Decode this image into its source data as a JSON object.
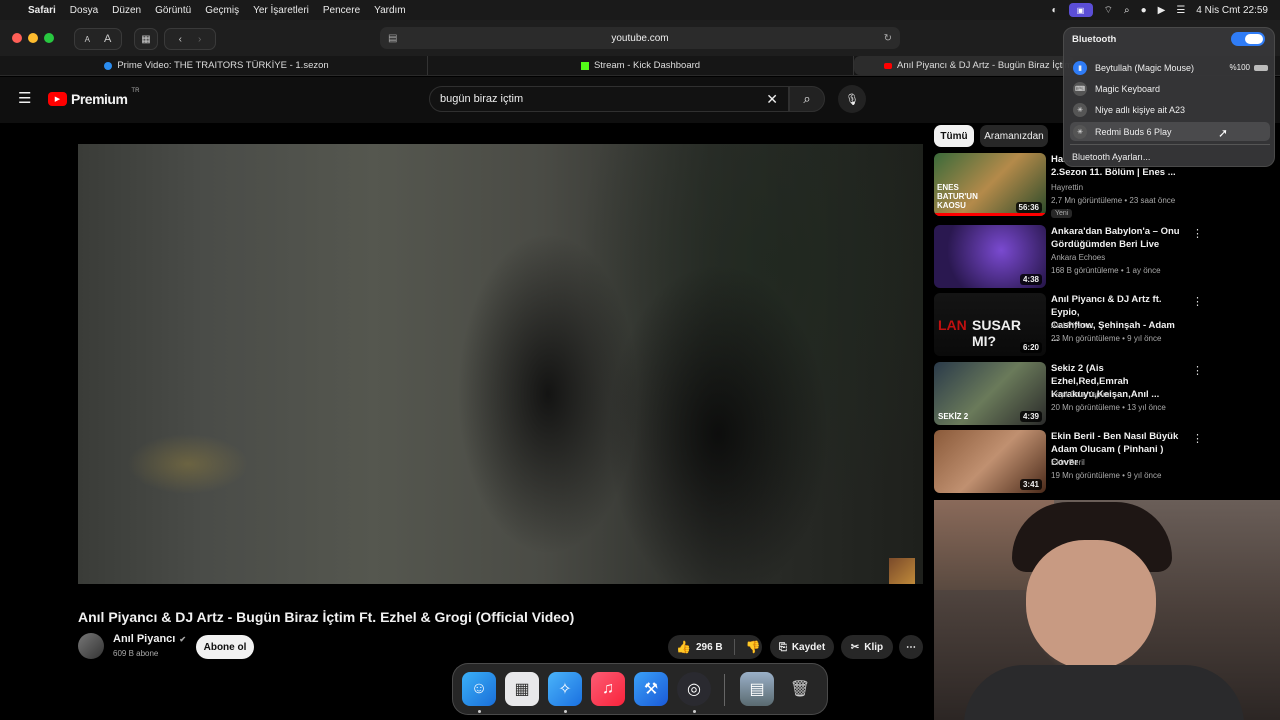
{
  "menubar": {
    "apple": "",
    "items": [
      "Safari",
      "Dosya",
      "Düzen",
      "Görüntü",
      "Geçmiş",
      "Yer İşaretleri",
      "Pencere",
      "Yardım"
    ],
    "clock": "4 Nis Cmt  22:59"
  },
  "safari": {
    "reader_small": "A",
    "reader_large": "A",
    "url": "youtube.com",
    "tabs": [
      {
        "label": "Prime Video: THE TRAITORS TÜRKİYE - 1.sezon"
      },
      {
        "label": "Stream - Kick Dashboard"
      },
      {
        "label": "Anıl Piyancı & DJ Artz - Bugün Biraz İçtim"
      }
    ]
  },
  "youtube": {
    "logo": "Premium",
    "region": "TR",
    "search_value": "bugün biraz içtim",
    "video_title": "Anıl Piyancı & DJ Artz - Bugün Biraz İçtim Ft. Ezhel & Grogi (Official Video)",
    "channel": "Anıl Piyancı",
    "subscribers": "609 B abone",
    "subscribe_label": "Abone ol",
    "likes": "296 B",
    "save_label": "Kaydet",
    "clip_label": "Klip",
    "chips": [
      "Tümü",
      "Aramanızdan"
    ],
    "recommendations": [
      {
        "title_line1": "Ha...",
        "title_line2": "2.Sezon 11. Bölüm | Enes ...",
        "channel": "Hayrettin",
        "meta": "2,7 Mn görüntüleme • 23 saat önce",
        "badge": "Yeni",
        "duration": "56:36",
        "thumb_text": "ENES BATUR'UN KAOSU"
      },
      {
        "title_line1": "Ankara'dan Babylon'a – Onu",
        "title_line2": "Gördüğümden Beri Live",
        "channel": "Ankara Echoes",
        "meta": "168 B görüntüleme • 1 ay önce",
        "badge": "",
        "duration": "4:38",
        "thumb_text": ""
      },
      {
        "title_line1": "Anıl Piyancı & DJ Artz ft. Eypio,",
        "title_line2": "Cashflow, Şehinşah - Adam ...",
        "channel": "Anıl Piyancı",
        "meta": "23 Mn görüntüleme • 9 yıl önce",
        "badge": "",
        "duration": "6:20",
        "thumb_text": "SUSAR MI?"
      },
      {
        "title_line1": "Sekiz 2 (Ais Ezhel,Red,Emrah",
        "title_line2": "Karakuyu,Keişan,Anıl ...",
        "channel": "Yeşil Oda Yapım",
        "meta": "20 Mn görüntüleme • 13 yıl önce",
        "badge": "",
        "duration": "4:39",
        "thumb_text": "SEKİZ 2"
      },
      {
        "title_line1": "Ekin Beril - Ben Nasıl Büyük",
        "title_line2": "Adam Olucam ( Pinhani ) Cover",
        "channel": "Ekin Beril",
        "meta": "19 Mn görüntüleme • 9 yıl önce",
        "badge": "",
        "duration": "3:41",
        "thumb_text": ""
      }
    ]
  },
  "bluetooth": {
    "title": "Bluetooth",
    "enabled": true,
    "devices": [
      {
        "name": "Beytullah (Magic Mouse)",
        "battery": "%100"
      },
      {
        "name": "Magic Keyboard",
        "battery": ""
      },
      {
        "name": "Niye adlı kişiye ait A23",
        "battery": ""
      },
      {
        "name": "Redmi Buds 6 Play",
        "battery": ""
      }
    ],
    "settings_label": "Bluetooth Ayarları..."
  },
  "dock": {
    "apps": [
      "finder-icon",
      "launchpad-icon",
      "safari-icon",
      "music-icon",
      "xcode-icon",
      "obs-icon",
      "photo-icon",
      "trash-icon"
    ]
  }
}
